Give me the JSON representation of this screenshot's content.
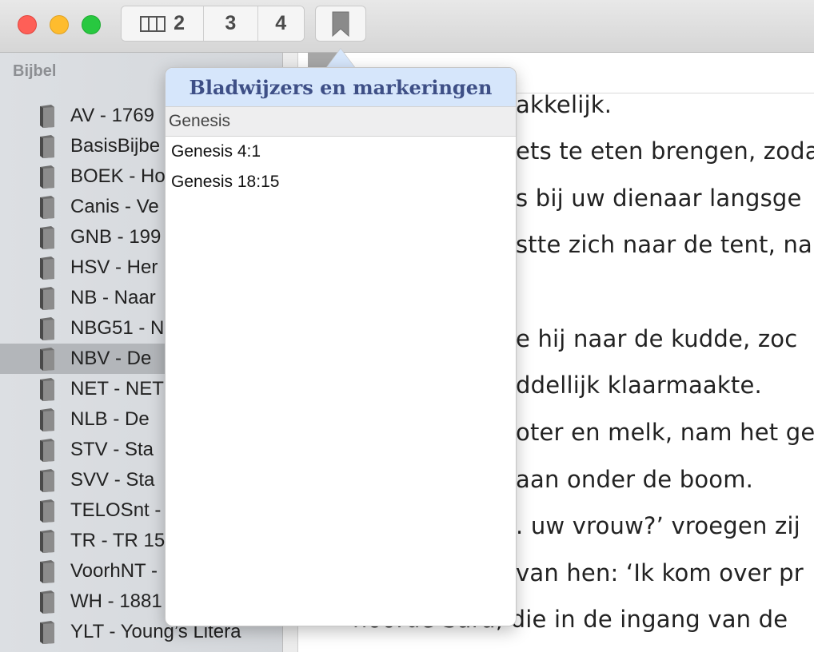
{
  "toolbar": {
    "columns": [
      {
        "label": "2",
        "icon": "columns-icon"
      },
      {
        "label": "3"
      },
      {
        "label": "4"
      }
    ],
    "bookmark_icon": "bookmark-icon"
  },
  "sidebar": {
    "header": "Bijbel",
    "items": [
      {
        "label": "AV - 1769"
      },
      {
        "label": "BasisBijbe"
      },
      {
        "label": "BOEK - Ho"
      },
      {
        "label": "Canis - Ve"
      },
      {
        "label": "GNB - 199"
      },
      {
        "label": "HSV - Her"
      },
      {
        "label": "NB - Naar"
      },
      {
        "label": "NBG51 - N"
      },
      {
        "label": "NBV - De",
        "selected": true
      },
      {
        "label": "NET - NET"
      },
      {
        "label": "NLB - De"
      },
      {
        "label": "STV - Sta"
      },
      {
        "label": "SVV - Sta"
      },
      {
        "label": "TELOSnt -"
      },
      {
        "label": "TR - TR 15"
      },
      {
        "label": "VoorhNT -"
      },
      {
        "label": "WH - 1881"
      },
      {
        "label": "YLT - Young’s Litera"
      }
    ]
  },
  "popover": {
    "title": "Bladwijzers en markeringen",
    "section": "Genesis",
    "bookmarks": [
      "Genesis 4:1",
      "Genesis 18:15"
    ]
  },
  "reader": {
    "lines": [
      "akkelijk.",
      "ets te eten brengen, zoda",
      "s bij uw dienaar langsge",
      "stte zich naar de tent, na",
      "",
      "e hij naar de kudde, zoc",
      "ddellijk klaarmaakte.",
      "oter en melk, nam het ge",
      "aan onder de boom.",
      ". uw vrouw?’ vroegen zij",
      "van hen: ‘Ik kom over pr",
      "hoorde Sara, die in de ingang van de"
    ]
  },
  "colors": {
    "popover_header_bg": "#d6e6fb",
    "popover_title": "#3e4f86",
    "selected_row": "#b3b6ba"
  }
}
